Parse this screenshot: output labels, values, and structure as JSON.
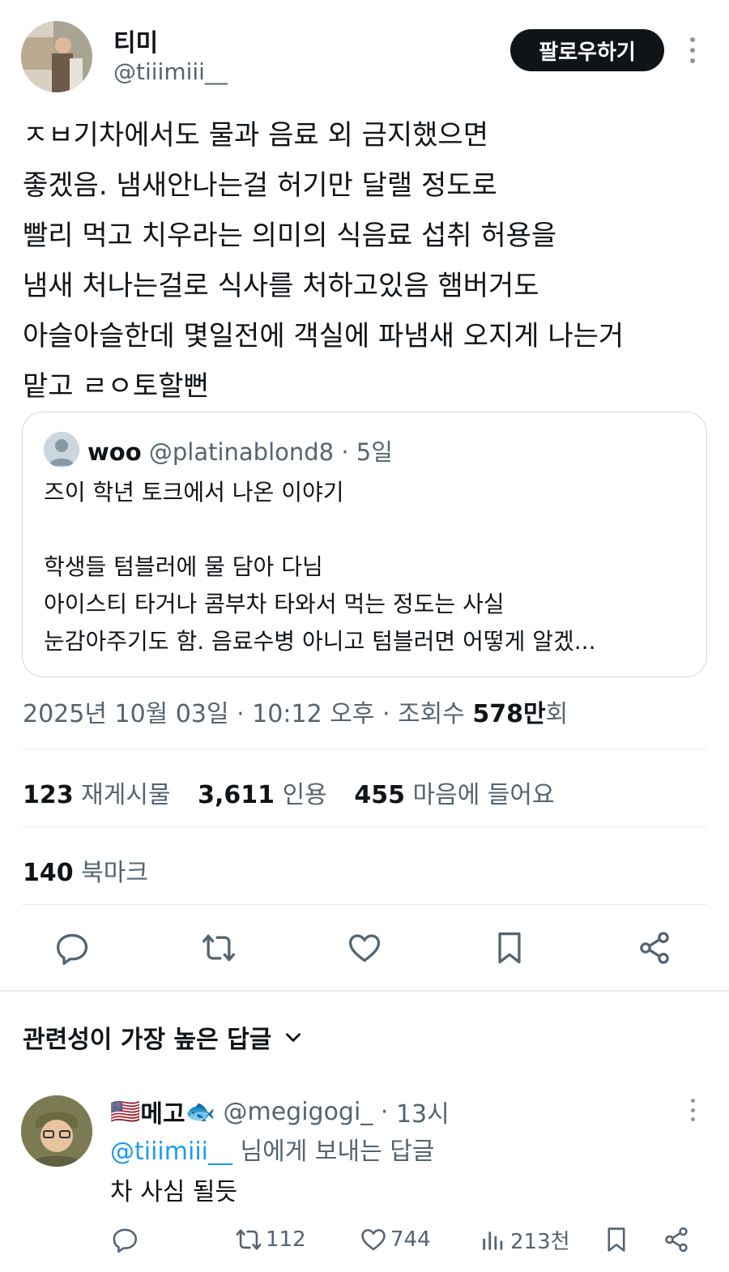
{
  "author": {
    "display_name": "티미",
    "handle": "@tiiimiii__",
    "follow_label": "팔로우하기"
  },
  "tweet": {
    "lines": [
      "ㅈㅂ기차에서도 물과 음료 외 금지했으면",
      "좋겠음. 냄새안나는걸 허기만 달랠 정도로",
      "빨리 먹고 치우라는 의미의 식음료 섭취 허용을",
      "냄새 처나는걸로 식사를 처하고있음 햄버거도",
      "아슬아슬한데 몇일전에 객실에 파냄새 오지게 나는거",
      "맡고 ㄹㅇ토할뻔"
    ]
  },
  "quote": {
    "name": "woo",
    "handle": "@platinablond8",
    "separator": "·",
    "age": "5일",
    "lines": [
      "즈이 학년 토크에서 나온 이야기",
      "",
      "학생들 텀블러에 물 담아 다님",
      "아이스티 타거나 콤부차 타와서 먹는 정도는 사실",
      "눈감아주기도 함. 음료수병 아니고 텀블러면 어떻게 알겠..."
    ]
  },
  "timestamp": {
    "date": "2025년 10월 03일",
    "sep1": "·",
    "time": "10:12 오후",
    "sep2": "·",
    "views_label": "조회수",
    "views_value": "578만",
    "views_suffix": "회"
  },
  "stats": {
    "reposts_value": "123",
    "reposts_label": "재게시물",
    "quotes_value": "3,611",
    "quotes_label": "인용",
    "likes_value": "455",
    "likes_label": "마음에 들어요",
    "bookmarks_value": "140",
    "bookmarks_label": "북마크"
  },
  "replies_section": {
    "sort_label": "관련성이 가장 높은 답글"
  },
  "reply": {
    "flag": "🇺🇸",
    "name": "메고",
    "fish": "🐟",
    "handle": "@megigogi_",
    "separator": "·",
    "age": "13시",
    "mention": "@tiiimiii__",
    "replying_suffix": " 님에게 보내는 답글",
    "text": "차 사심 될듯",
    "retweets": "112",
    "likes": "744",
    "views": "213천"
  },
  "icons": [
    "reply-icon",
    "retweet-icon",
    "like-icon",
    "bookmark-icon",
    "share-icon",
    "views-icon",
    "chevron-down-icon",
    "more-icon"
  ],
  "colors": {
    "text": "#0f1419",
    "secondary": "#536471",
    "accent": "#1d9bf0",
    "border": "#cfd9de",
    "button": "#0f1419"
  }
}
